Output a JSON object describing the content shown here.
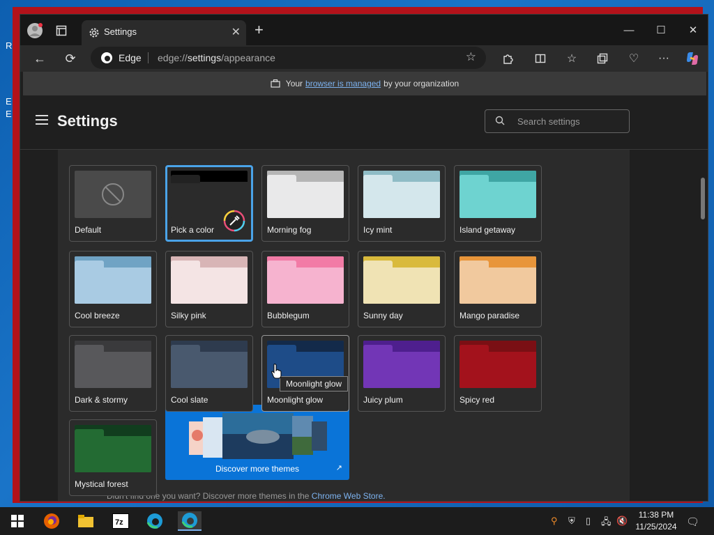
{
  "colors": {
    "accent": "#4aa3e8",
    "link": "#7db3f0",
    "discover_bg": "#0a74d8"
  },
  "browser": {
    "tab": {
      "title": "Settings",
      "icon": "gear-icon"
    },
    "address": {
      "brand": "Edge",
      "url_scheme": "edge://",
      "url_host": "settings",
      "url_path": "/appearance"
    }
  },
  "managed": {
    "prefix": "Your",
    "link": "browser is managed",
    "suffix": "by your organization"
  },
  "settings": {
    "title": "Settings",
    "search_placeholder": "Search settings"
  },
  "themes": [
    {
      "label": "Default",
      "top": "#4a4a4a",
      "tab": "#4a4a4a",
      "body": "#4a4a4a",
      "kind": "default"
    },
    {
      "label": "Pick a color",
      "top": "#000000",
      "tab": "#222222",
      "body": "#2b2b2b",
      "kind": "picker",
      "selected": true
    },
    {
      "label": "Morning fog",
      "top": "#b5b5b5",
      "tab": "#e9e9ea",
      "body": "#e9e9ea"
    },
    {
      "label": "Icy mint",
      "top": "#8fbcc6",
      "tab": "#d4e7ec",
      "body": "#d4e7ec"
    },
    {
      "label": "Island getaway",
      "top": "#3fa6a4",
      "tab": "#6ed3d0",
      "body": "#6ed3d0"
    },
    {
      "label": "Cool breeze",
      "top": "#70a3c4",
      "tab": "#a9cbe3",
      "body": "#a9cbe3"
    },
    {
      "label": "Silky pink",
      "top": "#d8b5b6",
      "tab": "#f4e4e4",
      "body": "#f4e4e4"
    },
    {
      "label": "Bubblegum",
      "top": "#f27ba6",
      "tab": "#f6b3cf",
      "body": "#f6b3cf"
    },
    {
      "label": "Sunny day",
      "top": "#d9ba3c",
      "tab": "#f0e3b4",
      "body": "#f0e3b4"
    },
    {
      "label": "Mango paradise",
      "top": "#e8953a",
      "tab": "#f1c99e",
      "body": "#f1c99e"
    },
    {
      "label": "Dark & stormy",
      "top": "#3a3a3c",
      "tab": "#58585b",
      "body": "#58585b"
    },
    {
      "label": "Cool slate",
      "top": "#2e3b4e",
      "tab": "#49596e",
      "body": "#49596e"
    },
    {
      "label": "Moonlight glow",
      "top": "#132a4a",
      "tab": "#1e4c88",
      "body": "#1e4c88",
      "hover": true
    },
    {
      "label": "Juicy plum",
      "top": "#4e1f8e",
      "tab": "#7236b6",
      "body": "#7236b6"
    },
    {
      "label": "Spicy red",
      "top": "#7a0f14",
      "tab": "#a3121c",
      "body": "#a3121c"
    },
    {
      "label": "Mystical forest",
      "top": "#113d1e",
      "tab": "#236b33",
      "body": "#236b33"
    }
  ],
  "discover": {
    "label": "Discover more themes"
  },
  "footer": {
    "text": "Didn't find one you want? Discover more themes in the",
    "link": "Chrome Web Store."
  },
  "tooltip": "Moonlight glow",
  "clock": {
    "time": "11:38 PM",
    "date": "11/25/2024"
  }
}
